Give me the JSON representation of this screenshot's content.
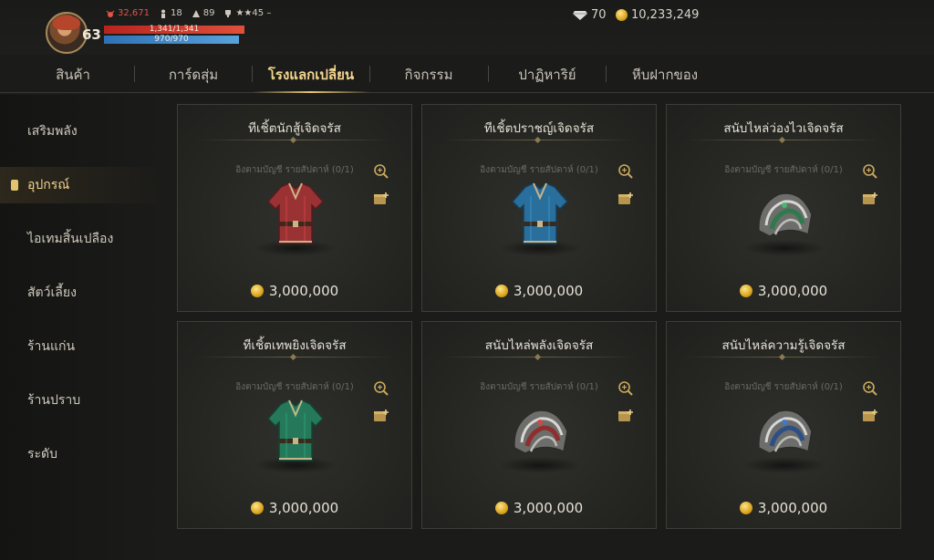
{
  "hud": {
    "level": "63",
    "power": "32,671",
    "stat_2": "18",
    "stat_3": "89",
    "stat_4": "45",
    "hp": "1,341/1,341",
    "mp": "970/970",
    "diamonds": "70",
    "gold": "10,233,249"
  },
  "tabs": [
    {
      "label": "สินค้า"
    },
    {
      "label": "การ์ดสุ่ม"
    },
    {
      "label": "โรงแลกเปลี่ยน"
    },
    {
      "label": "กิจกรรม"
    },
    {
      "label": "ปาฏิหาริย์"
    },
    {
      "label": "หีบฝากของ"
    }
  ],
  "active_tab": "โรงแลกเปลี่ยน",
  "sidebar": {
    "items": [
      {
        "label": "เสริมพลัง"
      },
      {
        "label": "อุปกรณ์"
      },
      {
        "label": "ไอเทมสิ้นเปลือง"
      },
      {
        "label": "สัตว์เลี้ยง"
      },
      {
        "label": "ร้านแก่น"
      },
      {
        "label": "ร้านปราบ"
      },
      {
        "label": "ระดับ"
      }
    ],
    "active": "อุปกรณ์"
  },
  "products": [
    {
      "title": "ทีเชิ้ตนักสู้เจิดจรัส",
      "limit": "อิงตามบัญชี รายสัปดาห์ (0/1)",
      "price": "3,000,000",
      "item": "shirt",
      "color": "#9a3234"
    },
    {
      "title": "ทีเชิ้ตปราชญ์เจิดจรัส",
      "limit": "อิงตามบัญชี รายสัปดาห์ (0/1)",
      "price": "3,000,000",
      "item": "shirt",
      "color": "#2a6f9c"
    },
    {
      "title": "สนับไหล่ว่องไวเจิดจรัส",
      "limit": "อิงตามบัญชี รายสัปดาห์ (0/1)",
      "price": "3,000,000",
      "item": "pauldron",
      "color": "#2f7a4c"
    },
    {
      "title": "ทีเชิ้ตเทพยิงเจิดจรัส",
      "limit": "อิงตามบัญชี รายสัปดาห์ (0/1)",
      "price": "3,000,000",
      "item": "shirt",
      "color": "#25795a"
    },
    {
      "title": "สนับไหล่พลังเจิดจรัส",
      "limit": "อิงตามบัญชี รายสัปดาห์ (0/1)",
      "price": "3,000,000",
      "item": "pauldron",
      "color": "#8e2e2e"
    },
    {
      "title": "สนับไหล่ความรู้เจิดจรัส",
      "limit": "อิงตามบัญชี รายสัปดาห์ (0/1)",
      "price": "3,000,000",
      "item": "pauldron",
      "color": "#2c4f86"
    }
  ]
}
